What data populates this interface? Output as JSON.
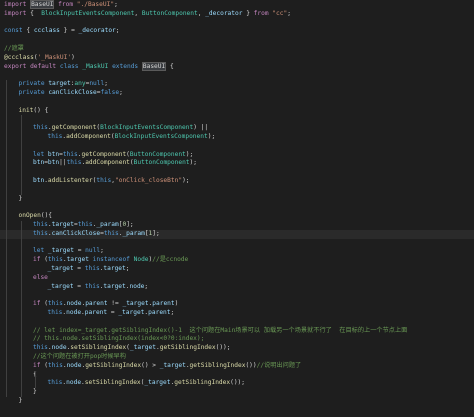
{
  "editor": {
    "lines": [
      {
        "indent": 0,
        "tokens": [
          [
            "kc",
            "import "
          ],
          [
            "hl",
            "BaseUI"
          ],
          [
            "kc",
            " from "
          ],
          [
            "s",
            "\"./BaseUI\""
          ],
          [
            "p",
            ";"
          ]
        ]
      },
      {
        "indent": 0,
        "tokens": [
          [
            "kc",
            "import "
          ],
          [
            "p",
            "{  "
          ],
          [
            "t",
            "BlockInputEventsComponent"
          ],
          [
            "p",
            ", "
          ],
          [
            "t",
            "ButtonComponent"
          ],
          [
            "p",
            ", "
          ],
          [
            "v",
            "_decorator"
          ],
          [
            "p",
            " } "
          ],
          [
            "kc",
            "from "
          ],
          [
            "s",
            "\"cc\""
          ],
          [
            "p",
            ";"
          ]
        ]
      },
      {
        "indent": 0,
        "tokens": []
      },
      {
        "indent": 0,
        "tokens": [
          [
            "k",
            "const "
          ],
          [
            "p",
            "{ "
          ],
          [
            "v",
            "ccclass"
          ],
          [
            "p",
            " } = "
          ],
          [
            "v",
            "_decorator"
          ],
          [
            "p",
            ";"
          ]
        ]
      },
      {
        "indent": 0,
        "tokens": []
      },
      {
        "indent": 0,
        "tokens": [
          [
            "c",
            "//遮罩"
          ]
        ]
      },
      {
        "indent": 0,
        "tokens": [
          [
            "f",
            "@ccclass"
          ],
          [
            "p",
            "("
          ],
          [
            "s",
            "'_MaskUI'"
          ],
          [
            "p",
            ")"
          ]
        ]
      },
      {
        "indent": 0,
        "tokens": [
          [
            "kc",
            "export "
          ],
          [
            "kc",
            "default "
          ],
          [
            "k",
            "class "
          ],
          [
            "t",
            "_MaskUI "
          ],
          [
            "k",
            "extends "
          ],
          [
            "hl",
            "BaseUI"
          ],
          [
            "p",
            " {"
          ]
        ]
      },
      {
        "indent": 0,
        "tokens": []
      },
      {
        "indent": 1,
        "tokens": [
          [
            "k",
            "private "
          ],
          [
            "v",
            "target"
          ],
          [
            "p",
            ":"
          ],
          [
            "t",
            "any"
          ],
          [
            "p",
            "="
          ],
          [
            "k",
            "null"
          ],
          [
            "p",
            ";"
          ]
        ]
      },
      {
        "indent": 1,
        "tokens": [
          [
            "k",
            "private "
          ],
          [
            "v",
            "canClickClose"
          ],
          [
            "p",
            "="
          ],
          [
            "k",
            "false"
          ],
          [
            "p",
            ";"
          ]
        ]
      },
      {
        "indent": 0,
        "tokens": []
      },
      {
        "indent": 1,
        "tokens": [
          [
            "f",
            "init"
          ],
          [
            "p",
            "() {"
          ]
        ]
      },
      {
        "indent": 0,
        "tokens": []
      },
      {
        "indent": 2,
        "tokens": [
          [
            "k",
            "this"
          ],
          [
            "p",
            "."
          ],
          [
            "f",
            "getComponent"
          ],
          [
            "p",
            "("
          ],
          [
            "t",
            "BlockInputEventsComponent"
          ],
          [
            "p",
            ") ||"
          ]
        ]
      },
      {
        "indent": 3,
        "tokens": [
          [
            "k",
            "this"
          ],
          [
            "p",
            "."
          ],
          [
            "f",
            "addComponent"
          ],
          [
            "p",
            "("
          ],
          [
            "t",
            "BlockInputEventsComponent"
          ],
          [
            "p",
            ");"
          ]
        ]
      },
      {
        "indent": 0,
        "tokens": []
      },
      {
        "indent": 2,
        "tokens": [
          [
            "k",
            "let "
          ],
          [
            "v",
            "btn"
          ],
          [
            "p",
            "="
          ],
          [
            "k",
            "this"
          ],
          [
            "p",
            "."
          ],
          [
            "f",
            "getComponent"
          ],
          [
            "p",
            "("
          ],
          [
            "t",
            "ButtonComponent"
          ],
          [
            "p",
            ");"
          ]
        ]
      },
      {
        "indent": 2,
        "tokens": [
          [
            "v",
            "btn"
          ],
          [
            "p",
            "="
          ],
          [
            "v",
            "btn"
          ],
          [
            "p",
            "||"
          ],
          [
            "k",
            "this"
          ],
          [
            "p",
            "."
          ],
          [
            "f",
            "addComponent"
          ],
          [
            "p",
            "("
          ],
          [
            "t",
            "ButtonComponent"
          ],
          [
            "p",
            ");"
          ]
        ]
      },
      {
        "indent": 0,
        "tokens": []
      },
      {
        "indent": 2,
        "tokens": [
          [
            "v",
            "btn"
          ],
          [
            "p",
            "."
          ],
          [
            "f",
            "addListenter"
          ],
          [
            "p",
            "("
          ],
          [
            "k",
            "this"
          ],
          [
            "p",
            ","
          ],
          [
            "s",
            "\"onClick_closeBtn\""
          ],
          [
            "p",
            ");"
          ]
        ]
      },
      {
        "indent": 0,
        "tokens": []
      },
      {
        "indent": 1,
        "tokens": [
          [
            "p",
            "}"
          ]
        ]
      },
      {
        "indent": 0,
        "tokens": []
      },
      {
        "indent": 1,
        "tokens": [
          [
            "f",
            "onOpen"
          ],
          [
            "p",
            "(){"
          ]
        ]
      },
      {
        "indent": 2,
        "tokens": [
          [
            "k",
            "this"
          ],
          [
            "p",
            "."
          ],
          [
            "v",
            "target"
          ],
          [
            "p",
            "="
          ],
          [
            "k",
            "this"
          ],
          [
            "p",
            "."
          ],
          [
            "v",
            "_param"
          ],
          [
            "p",
            "["
          ],
          [
            "n",
            "0"
          ],
          [
            "p",
            "];"
          ]
        ]
      },
      {
        "indent": 2,
        "tokens": [
          [
            "k",
            "this"
          ],
          [
            "p",
            "."
          ],
          [
            "v",
            "canClickClose"
          ],
          [
            "p",
            "="
          ],
          [
            "k",
            "this"
          ],
          [
            "p",
            "."
          ],
          [
            "v",
            "_param"
          ],
          [
            "p",
            "["
          ],
          [
            "n",
            "1"
          ],
          [
            "p",
            "];"
          ]
        ],
        "current": true
      },
      {
        "indent": 0,
        "tokens": []
      },
      {
        "indent": 2,
        "tokens": [
          [
            "k",
            "let "
          ],
          [
            "v",
            "_target"
          ],
          [
            "p",
            " = "
          ],
          [
            "k",
            "null"
          ],
          [
            "p",
            ";"
          ]
        ]
      },
      {
        "indent": 2,
        "tokens": [
          [
            "kc",
            "if "
          ],
          [
            "p",
            "("
          ],
          [
            "k",
            "this"
          ],
          [
            "p",
            "."
          ],
          [
            "v",
            "target "
          ],
          [
            "k",
            "instanceof "
          ],
          [
            "t",
            "Node"
          ],
          [
            "p",
            ")"
          ],
          [
            "c",
            "//是ccnode"
          ]
        ]
      },
      {
        "indent": 3,
        "tokens": [
          [
            "v",
            "_target"
          ],
          [
            "p",
            " = "
          ],
          [
            "k",
            "this"
          ],
          [
            "p",
            "."
          ],
          [
            "v",
            "target"
          ],
          [
            "p",
            ";"
          ]
        ]
      },
      {
        "indent": 2,
        "tokens": [
          [
            "kc",
            "else"
          ]
        ]
      },
      {
        "indent": 3,
        "tokens": [
          [
            "v",
            "_target"
          ],
          [
            "p",
            " = "
          ],
          [
            "k",
            "this"
          ],
          [
            "p",
            "."
          ],
          [
            "v",
            "target"
          ],
          [
            "p",
            "."
          ],
          [
            "v",
            "node"
          ],
          [
            "p",
            ";"
          ]
        ]
      },
      {
        "indent": 0,
        "tokens": []
      },
      {
        "indent": 2,
        "tokens": [
          [
            "kc",
            "if "
          ],
          [
            "p",
            "("
          ],
          [
            "k",
            "this"
          ],
          [
            "p",
            "."
          ],
          [
            "v",
            "node"
          ],
          [
            "p",
            "."
          ],
          [
            "v",
            "parent"
          ],
          [
            "p",
            " != "
          ],
          [
            "v",
            "_target"
          ],
          [
            "p",
            "."
          ],
          [
            "v",
            "parent"
          ],
          [
            "p",
            ")"
          ]
        ]
      },
      {
        "indent": 3,
        "tokens": [
          [
            "k",
            "this"
          ],
          [
            "p",
            "."
          ],
          [
            "v",
            "node"
          ],
          [
            "p",
            "."
          ],
          [
            "v",
            "parent"
          ],
          [
            "p",
            " = "
          ],
          [
            "v",
            "_target"
          ],
          [
            "p",
            "."
          ],
          [
            "v",
            "parent"
          ],
          [
            "p",
            ";"
          ]
        ]
      },
      {
        "indent": 0,
        "tokens": []
      },
      {
        "indent": 2,
        "tokens": [
          [
            "c",
            "// let index=_target.getSiblingIndex()-1  这个问题在Main场景可以 加载另一个场景就不行了  在目标的上一个节点上面"
          ]
        ]
      },
      {
        "indent": 2,
        "tokens": [
          [
            "c",
            "// this.node.setSiblingIndex(index<0?0:index);"
          ]
        ]
      },
      {
        "indent": 2,
        "tokens": [
          [
            "k",
            "this"
          ],
          [
            "p",
            "."
          ],
          [
            "v",
            "node"
          ],
          [
            "p",
            "."
          ],
          [
            "f",
            "setSiblingIndex"
          ],
          [
            "p",
            "("
          ],
          [
            "v",
            "_target"
          ],
          [
            "p",
            "."
          ],
          [
            "f",
            "getSiblingIndex"
          ],
          [
            "p",
            "());"
          ]
        ]
      },
      {
        "indent": 2,
        "tokens": [
          [
            "c",
            "//这个问题在被打开pop时候早构"
          ]
        ]
      },
      {
        "indent": 2,
        "tokens": [
          [
            "kc",
            "if "
          ],
          [
            "p",
            "("
          ],
          [
            "k",
            "this"
          ],
          [
            "p",
            "."
          ],
          [
            "v",
            "node"
          ],
          [
            "p",
            "."
          ],
          [
            "f",
            "getSiblingIndex"
          ],
          [
            "p",
            "() > "
          ],
          [
            "v",
            "_target"
          ],
          [
            "p",
            "."
          ],
          [
            "f",
            "getSiblingIndex"
          ],
          [
            "p",
            "())"
          ],
          [
            "c",
            "//说明出问题了"
          ]
        ]
      },
      {
        "indent": 2,
        "tokens": [
          [
            "p",
            "{"
          ]
        ]
      },
      {
        "indent": 3,
        "tokens": [
          [
            "k",
            "this"
          ],
          [
            "p",
            "."
          ],
          [
            "v",
            "node"
          ],
          [
            "p",
            "."
          ],
          [
            "f",
            "setSiblingIndex"
          ],
          [
            "p",
            "("
          ],
          [
            "v",
            "_target"
          ],
          [
            "p",
            "."
          ],
          [
            "f",
            "getSiblingIndex"
          ],
          [
            "p",
            "());"
          ]
        ]
      },
      {
        "indent": 2,
        "tokens": [
          [
            "p",
            "}"
          ]
        ]
      },
      {
        "indent": 1,
        "tokens": [
          [
            "p",
            "}"
          ]
        ]
      },
      {
        "indent": 0,
        "tokens": []
      }
    ]
  }
}
